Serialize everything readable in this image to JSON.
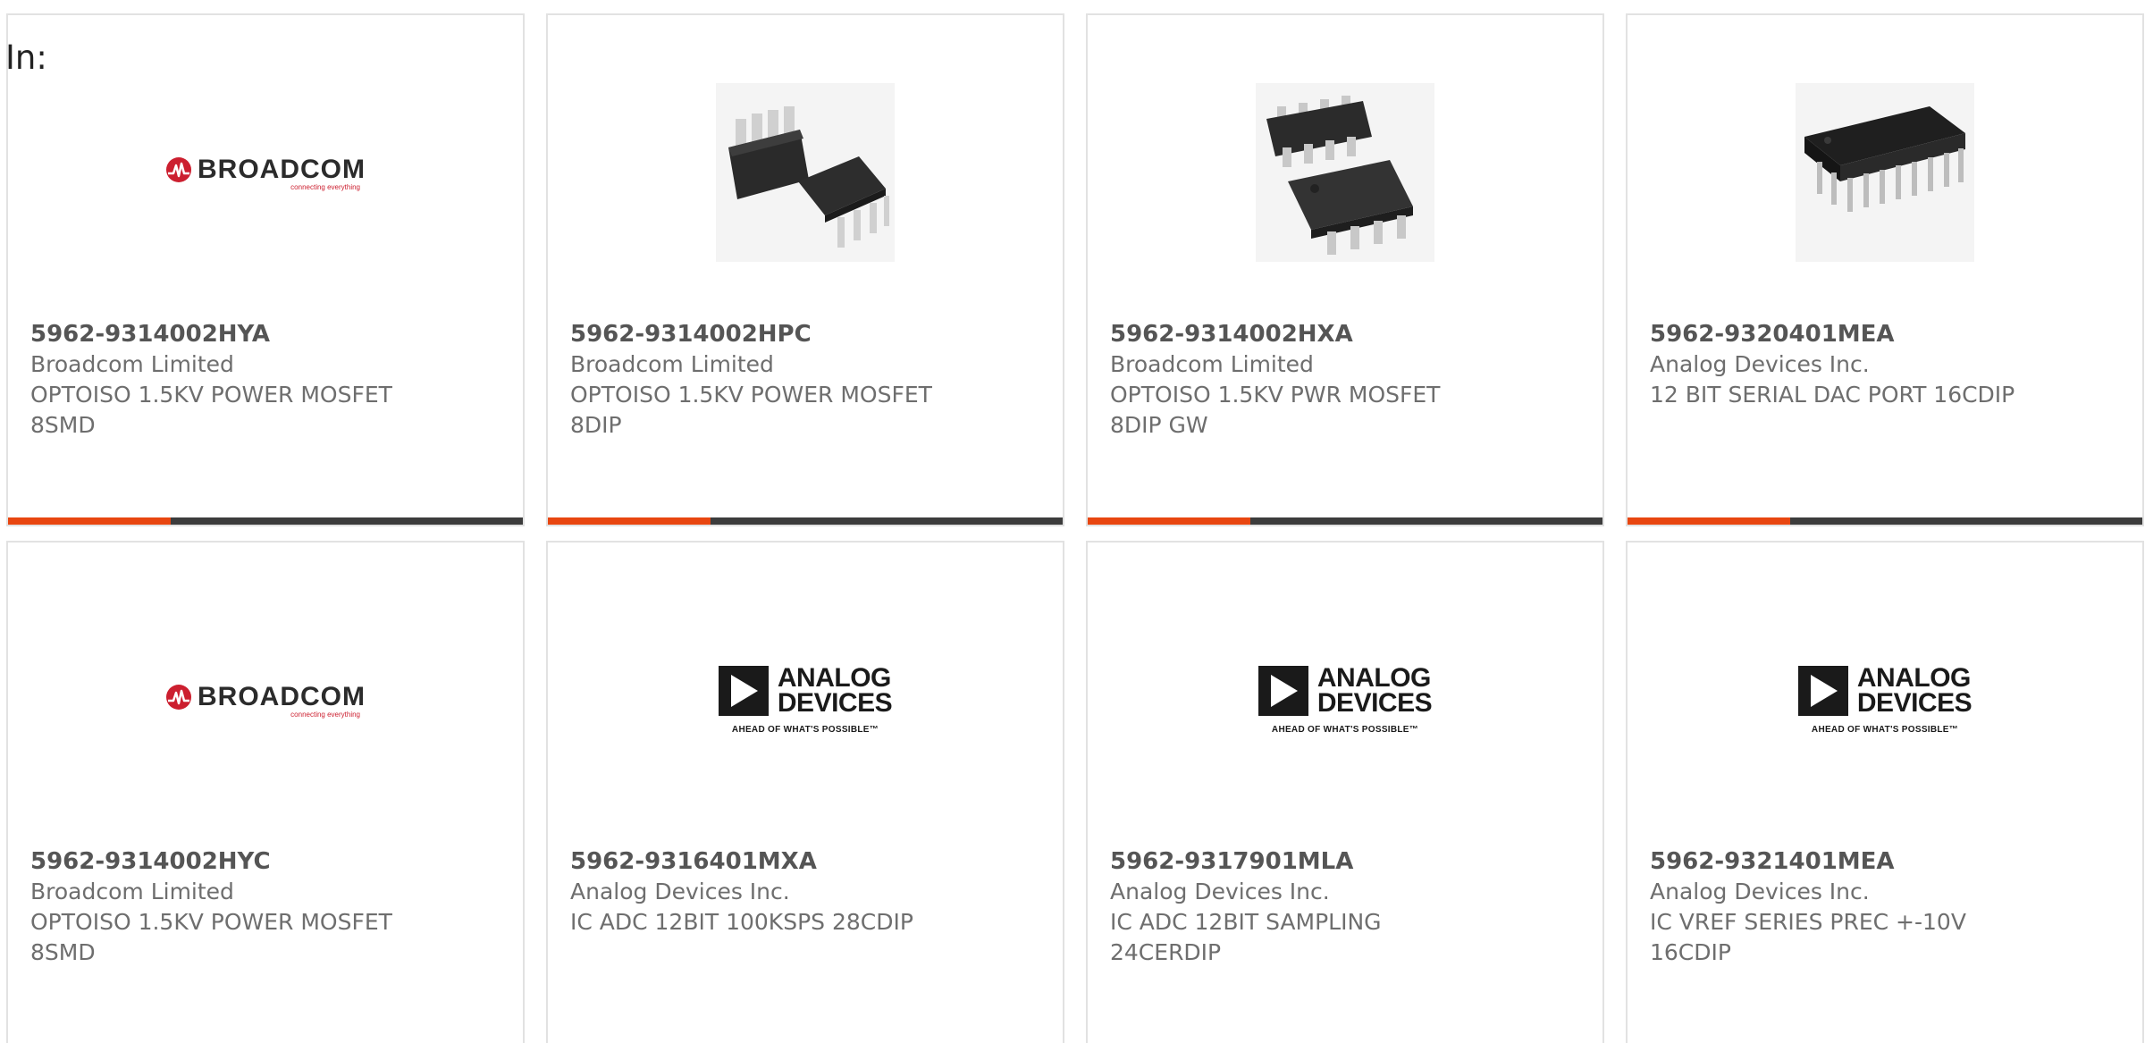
{
  "filter": {
    "label": "In:"
  },
  "logos": {
    "broadcom": {
      "name": "BROADCOM",
      "tagline": "connecting everything"
    },
    "analog_devices": {
      "line1": "ANALOG",
      "line2": "DEVICES",
      "tagline": "AHEAD OF WHAT'S POSSIBLE™"
    }
  },
  "colors": {
    "accent": "#e84610",
    "bar": "#3c3c3c",
    "broadcom_red": "#cc1f2f"
  },
  "products": [
    {
      "part": "5962-9314002HYA",
      "manufacturer": "Broadcom Limited",
      "description": "OPTOISO 1.5KV POWER MOSFET\n8SMD",
      "image": "broadcom-logo"
    },
    {
      "part": "5962-9314002HPC",
      "manufacturer": "Broadcom Limited",
      "description": "OPTOISO 1.5KV POWER MOSFET\n8DIP",
      "image": "dip8-chips"
    },
    {
      "part": "5962-9314002HXA",
      "manufacturer": "Broadcom Limited",
      "description": "OPTOISO 1.5KV PWR MOSFET\n8DIP GW",
      "image": "smd8-chips"
    },
    {
      "part": "5962-9320401MEA",
      "manufacturer": "Analog Devices Inc.",
      "description": "12 BIT SERIAL DAC PORT 16CDIP",
      "image": "cdip16-chip"
    },
    {
      "part": "5962-9314002HYC",
      "manufacturer": "Broadcom Limited",
      "description": "OPTOISO 1.5KV POWER MOSFET\n8SMD",
      "image": "broadcom-logo"
    },
    {
      "part": "5962-9316401MXA",
      "manufacturer": "Analog Devices Inc.",
      "description": "IC ADC 12BIT 100KSPS 28CDIP",
      "image": "analog-devices-logo"
    },
    {
      "part": "5962-9317901MLA",
      "manufacturer": "Analog Devices Inc.",
      "description": "IC ADC 12BIT SAMPLING\n24CERDIP",
      "image": "analog-devices-logo"
    },
    {
      "part": "5962-9321401MEA",
      "manufacturer": "Analog Devices Inc.",
      "description": "IC VREF SERIES PREC +-10V\n16CDIP",
      "image": "analog-devices-logo"
    }
  ]
}
